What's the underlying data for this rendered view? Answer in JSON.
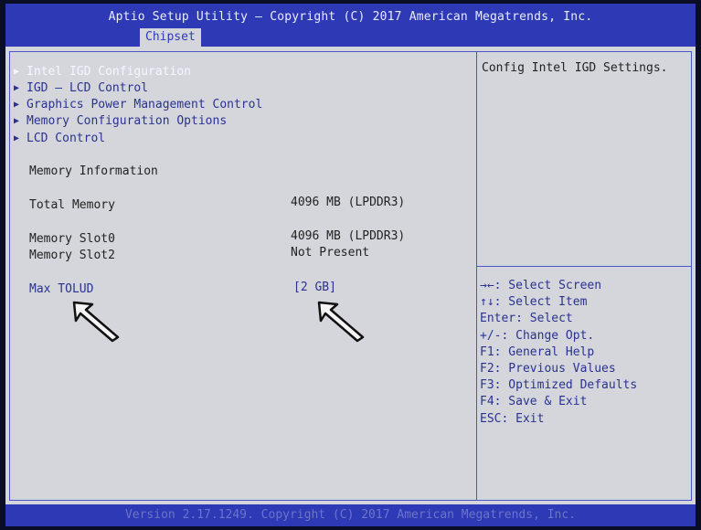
{
  "header": {
    "title": "Aptio Setup Utility – Copyright (C) 2017 American Megatrends, Inc.",
    "active_tab": "Chipset"
  },
  "menu": [
    {
      "label": "Intel IGD Configuration",
      "selected": true
    },
    {
      "label": "IGD – LCD Control",
      "selected": false
    },
    {
      "label": "Graphics Power Management Control",
      "selected": false
    },
    {
      "label": "Memory Configuration Options",
      "selected": false
    },
    {
      "label": "LCD Control",
      "selected": false
    }
  ],
  "memory_info": {
    "heading": "Memory Information",
    "total_label": "Total Memory",
    "total_value": "4096 MB (LPDDR3)",
    "slot0_label": "Memory Slot0",
    "slot0_value": "4096 MB (LPDDR3)",
    "slot2_label": "Memory Slot2",
    "slot2_value": "Not Present"
  },
  "setting": {
    "label": "Max TOLUD",
    "value": "[2 GB]"
  },
  "help": {
    "description": "Config Intel IGD Settings.",
    "keys": [
      "→←: Select Screen",
      "↑↓: Select Item",
      "Enter: Select",
      "+/-: Change Opt.",
      "F1: General Help",
      "F2: Previous Values",
      "F3: Optimized Defaults",
      "F4: Save & Exit",
      "ESC: Exit"
    ]
  },
  "footer": "Version 2.17.1249. Copyright (C) 2017 American Megatrends, Inc.",
  "colors": {
    "header_bg": "#2e3ab5",
    "body_bg": "#d4d6dc",
    "menu_text": "#2a3290",
    "selected_text": "#f5f6ff"
  }
}
